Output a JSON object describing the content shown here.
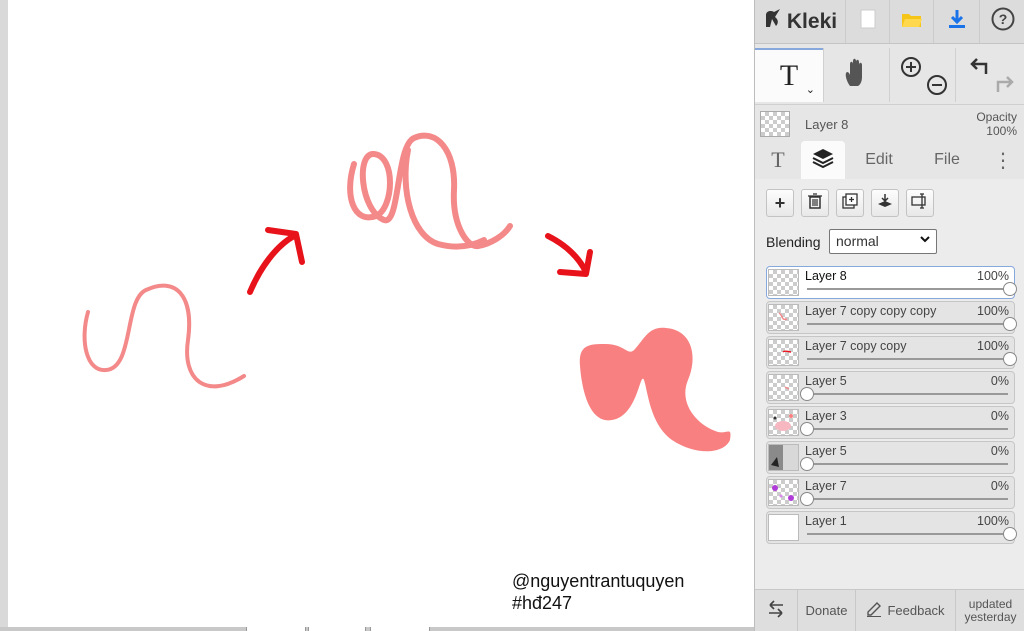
{
  "app": {
    "name": "Kleki"
  },
  "canvas": {
    "watermark_line1": "@nguyentrantuquyen",
    "watermark_line2": "#hđ247"
  },
  "topbar": {
    "icons": [
      "kleki-logo-icon",
      "new-image-icon",
      "open-folder-icon",
      "save-download-icon",
      "help-icon"
    ]
  },
  "tools": {
    "text_tool": "T",
    "items": [
      "text-tool-icon",
      "hand-tool-icon",
      "zoom-in-icon",
      "zoom-out-icon",
      "undo-icon",
      "redo-icon"
    ]
  },
  "active_layer": {
    "name": "Layer 8",
    "opacity_label": "Opacity",
    "opacity_value": "100%"
  },
  "tabs": {
    "text": "T",
    "edit": "Edit",
    "file": "File",
    "more": "⋮"
  },
  "layer_buttons": [
    "add-layer-icon",
    "delete-layer-icon",
    "duplicate-layer-icon",
    "merge-down-icon",
    "rename-layer-icon"
  ],
  "blending": {
    "label": "Blending",
    "value": "normal"
  },
  "layers": [
    {
      "name": "Layer 8",
      "opacity": "100%",
      "value": 1.0,
      "selected": true
    },
    {
      "name": "Layer 7 copy copy copy",
      "opacity": "100%",
      "value": 1.0
    },
    {
      "name": "Layer 7 copy copy",
      "opacity": "100%",
      "value": 1.0
    },
    {
      "name": "Layer 5",
      "opacity": "0%",
      "value": 0.0
    },
    {
      "name": "Layer 3",
      "opacity": "0%",
      "value": 0.0
    },
    {
      "name": "Layer 5",
      "opacity": "0%",
      "value": 0.0
    },
    {
      "name": "Layer 7",
      "opacity": "0%",
      "value": 0.0
    },
    {
      "name": "Layer 1",
      "opacity": "100%",
      "value": 1.0
    }
  ],
  "footer": {
    "donate": "Donate",
    "feedback": "Feedback",
    "updated_line1": "updated",
    "updated_line2": "yesterday"
  },
  "colors": {
    "stroke_pink": "#f4898a",
    "fill_salmon": "#f98080",
    "arrow_red": "#e8131a",
    "accent_blue": "#86a8dd",
    "download_blue": "#1a73e8",
    "folder_yellow": "#f5c518"
  }
}
